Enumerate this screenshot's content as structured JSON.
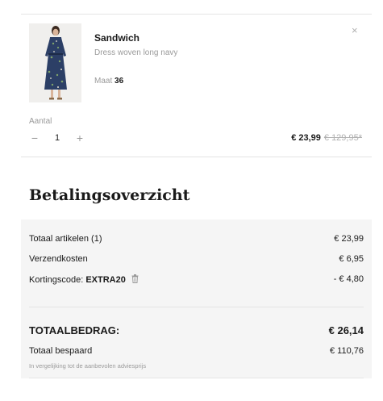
{
  "cart_item": {
    "brand": "Sandwich",
    "description": "Dress woven long navy",
    "size_label": "Maat",
    "size_value": "36",
    "quantity_label": "Aantal",
    "quantity_value": "1",
    "minus_symbol": "−",
    "plus_symbol": "+",
    "close_symbol": "×",
    "price_current": "€ 23,99",
    "price_original": "€ 129,95*"
  },
  "summary": {
    "title": "Betalingsoverzicht",
    "rows": [
      {
        "label": "Totaal artikelen (1)",
        "value": "€ 23,99"
      },
      {
        "label": "Verzendkosten",
        "value": "€ 6,95"
      }
    ],
    "discount_label": "Kortingscode:",
    "discount_code": "EXTRA20",
    "discount_value": "- € 4,80",
    "total_label": "TOTAALBEDRAG:",
    "total_value": "€ 26,14",
    "saved_label": "Totaal bespaard",
    "saved_value": "€ 110,76",
    "saved_note": "In vergelijking tot de aanbevolen adviesprijs"
  },
  "icons": {
    "close": "close-icon",
    "trash": "trash-icon",
    "product_image": "dress-photo"
  }
}
